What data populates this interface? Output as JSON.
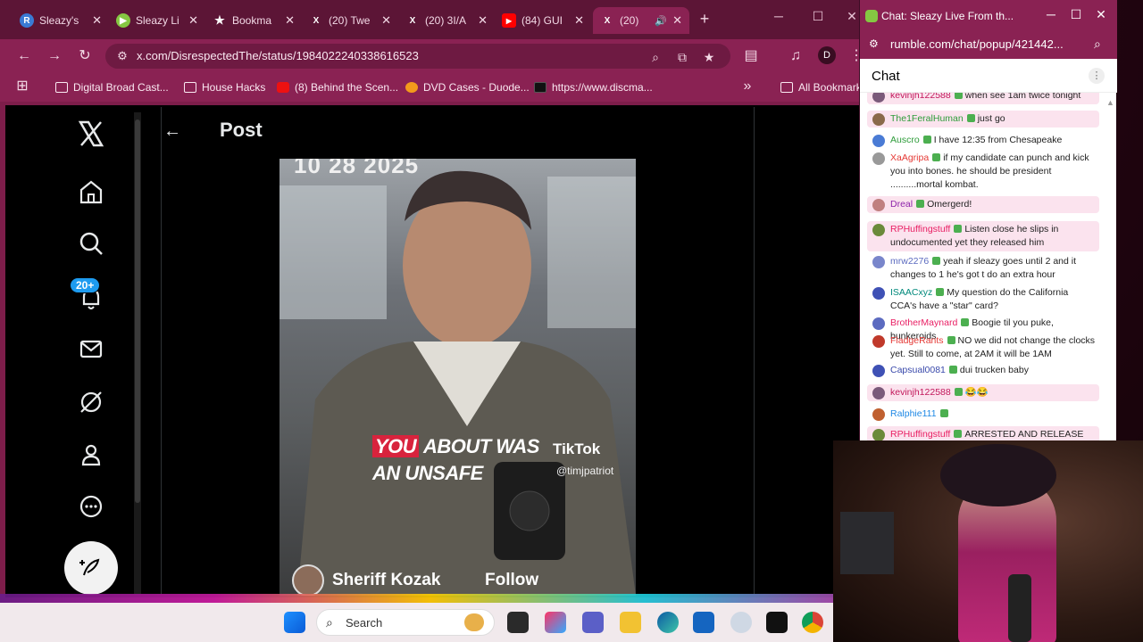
{
  "browser": {
    "tabs": [
      {
        "label": "Sleazy's",
        "favicon": "R",
        "color": "#3a7bd5",
        "active": false
      },
      {
        "label": "Sleazy Li",
        "favicon": "▶",
        "color": "#85c742",
        "active": false
      },
      {
        "label": "Bookma",
        "favicon": "★",
        "color": "#5c1536",
        "active": false
      },
      {
        "label": "(20) Twe",
        "favicon": "X",
        "color": "#000000",
        "active": false
      },
      {
        "label": "(20) 3I/A",
        "favicon": "X",
        "color": "#000000",
        "active": false
      },
      {
        "label": "(84) GUI",
        "favicon": "▶",
        "color": "#ff0000",
        "active": false
      },
      {
        "label": "(20)",
        "favicon": "X",
        "color": "#000000",
        "active": true
      }
    ],
    "url": "x.com/DisrespectedThe/status/1984022240338616523",
    "profile_initial": "D",
    "bookmarks": [
      {
        "label": "Digital Broad Cast...",
        "icon": "folder"
      },
      {
        "label": "House Hacks",
        "icon": "folder"
      },
      {
        "label": "(8) Behind the Scen...",
        "icon": "youtube"
      },
      {
        "label": "DVD Cases - Duode...",
        "icon": "orange"
      },
      {
        "label": "https://www.discma...",
        "icon": "dark"
      },
      {
        "label": "All Bookmarks",
        "icon": "folder"
      }
    ]
  },
  "x": {
    "notifications_badge": "20+",
    "post_title": "Post",
    "video": {
      "date_overlay": "10 28 2025",
      "caption_line1_highlight": "YOU",
      "caption_line1_rest": " ABOUT WAS",
      "caption_line2": "AN UNSAFE",
      "tiktok_label": "TikTok",
      "tiktok_handle": "@timjpatriot",
      "author": "Sheriff Kozak",
      "follow_label": "Follow"
    }
  },
  "taskbar": {
    "search_label": "Search"
  },
  "chat_window": {
    "title": "Chat: Sleazy Live From th...",
    "url": "rumble.com/chat/popup/421442...",
    "header": "Chat",
    "messages": [
      {
        "user": "kevinjh122588",
        "user_color": "#c2185b",
        "text": "when see 1am twice tonight",
        "avatar": "#7a5a7a",
        "highlight": true,
        "cut": true
      },
      {
        "user": "The1FeralHuman",
        "user_color": "#2e9c3a",
        "text": "just go",
        "avatar": "#8a6a4a",
        "highlight": true
      },
      {
        "user": "Auscro",
        "user_color": "#2e9c3a",
        "text": "I have 12:35 from Chesapeake",
        "avatar": "#4a7bd5",
        "highlight": false
      },
      {
        "user": "XaAgripa",
        "user_color": "#e53935",
        "text": "if my candidate can punch and kick you into bones. he should be president ..........mortal kombat.",
        "avatar": "#999999",
        "highlight": false
      },
      {
        "user": "Dreal",
        "user_color": "#8e24aa",
        "text": "Omergerd!",
        "avatar": "#c08080",
        "highlight": true
      },
      {
        "user": "RPHuffingstuff",
        "user_color": "#e91e63",
        "text": "Listen close he slips in undocumented yet they released him",
        "avatar": "#6a8a3a",
        "highlight": true
      },
      {
        "user": "mrw2276",
        "user_color": "#5c6bc0",
        "text": "yeah if sleazy goes until 2 and it changes to 1 he's got t do an extra hour",
        "avatar": "#7986cb",
        "highlight": false
      },
      {
        "user": "ISAACxyz",
        "user_color": "#00897b",
        "text": "My question do the California CCA's have a \"star\" card?",
        "avatar": "#3f51b5",
        "highlight": false
      },
      {
        "user": "BrotherMaynard",
        "user_color": "#e91e63",
        "text": "Boogie til you puke, bunkeroids",
        "avatar": "#5c6bc0",
        "highlight": false
      },
      {
        "user": "FladgeRants",
        "user_color": "#e53935",
        "text": "NO we did not change the clocks yet. Still to come, at 2AM it will be 1AM",
        "avatar": "#c0392b",
        "highlight": false
      },
      {
        "user": "Capsual0081",
        "user_color": "#3949ab",
        "text": "dui trucken baby",
        "avatar": "#3f51b5",
        "highlight": false
      },
      {
        "user": "kevinjh122588",
        "user_color": "#c2185b",
        "text": "😂😂",
        "avatar": "#7a5a7a",
        "highlight": true
      },
      {
        "user": "Ralphie111",
        "user_color": "#1e88e5",
        "text": "",
        "avatar": "#c06030",
        "highlight": false
      },
      {
        "user": "RPHuffingstuff",
        "user_color": "#e91e63",
        "text": "ARRESTED AND RELEASE",
        "avatar": "#6a8a3a",
        "highlight": true
      }
    ]
  }
}
